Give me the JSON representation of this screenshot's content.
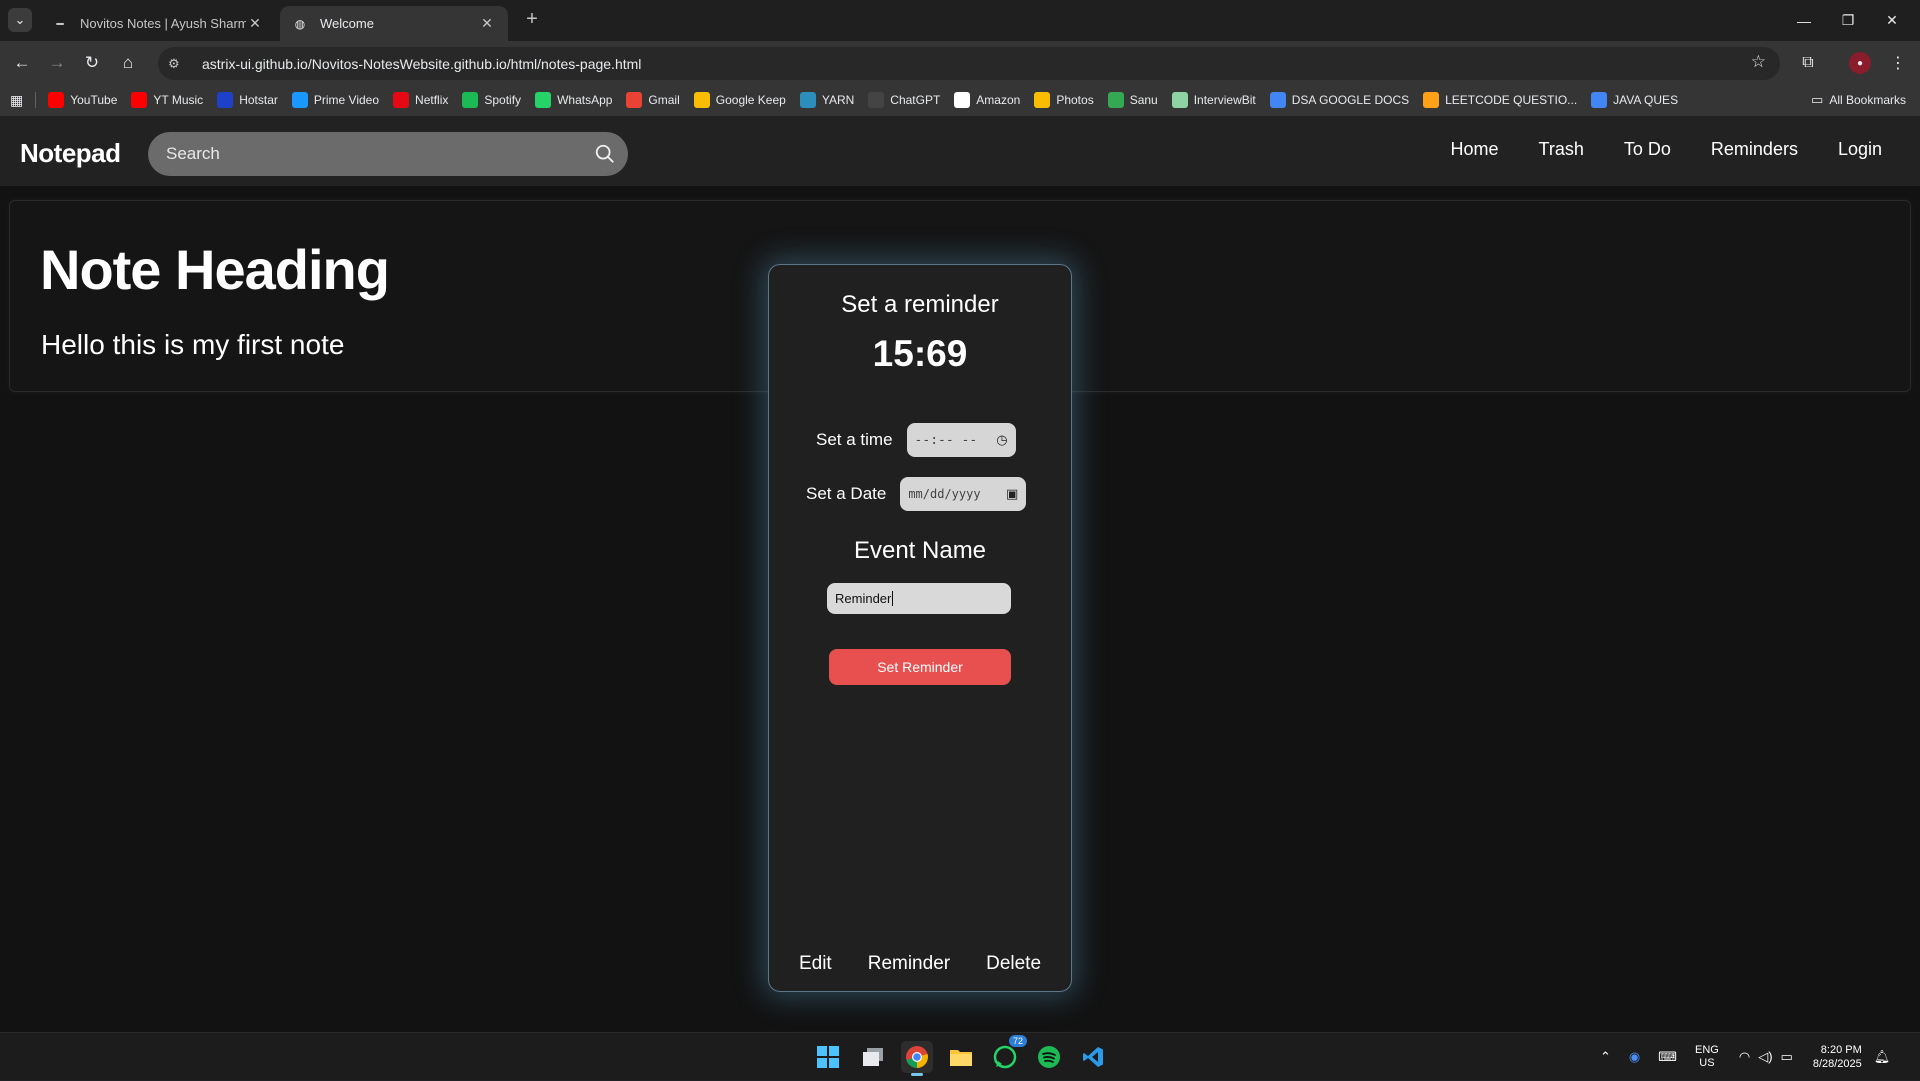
{
  "browser": {
    "tabs": [
      {
        "title": "Novitos Notes | Ayush Sharma",
        "active": false
      },
      {
        "title": "Welcome",
        "active": true
      }
    ],
    "url": "astrix-ui.github.io/Novitos-NotesWebsite.github.io/html/notes-page.html",
    "bookmarks": [
      {
        "label": "YouTube",
        "color": "#ff0000"
      },
      {
        "label": "YT Music",
        "color": "#ff0000"
      },
      {
        "label": "Hotstar",
        "color": "#1f41c9"
      },
      {
        "label": "Prime Video",
        "color": "#1a98ff"
      },
      {
        "label": "Netflix",
        "color": "#e50914"
      },
      {
        "label": "Spotify",
        "color": "#1db954"
      },
      {
        "label": "WhatsApp",
        "color": "#25d366"
      },
      {
        "label": "Gmail",
        "color": "#ea4335"
      },
      {
        "label": "Google Keep",
        "color": "#fbbc04"
      },
      {
        "label": "YARN",
        "color": "#2c8ebb"
      },
      {
        "label": "ChatGPT",
        "color": "#444444"
      },
      {
        "label": "Amazon",
        "color": "#ffffff"
      },
      {
        "label": "Photos",
        "color": "#fbbc04"
      },
      {
        "label": "Sanu",
        "color": "#34a853"
      },
      {
        "label": "InterviewBit",
        "color": "#8fd3a5"
      },
      {
        "label": "DSA GOOGLE DOCS",
        "color": "#4285f4"
      },
      {
        "label": "LEETCODE QUESTIO...",
        "color": "#ffa116"
      },
      {
        "label": "JAVA QUES",
        "color": "#4285f4"
      }
    ],
    "all_bookmarks": "All Bookmarks"
  },
  "app": {
    "brand": "Notepad",
    "search_placeholder": "Search",
    "nav": [
      "Home",
      "Trash",
      "To Do",
      "Reminders",
      "Login"
    ]
  },
  "note": {
    "heading": "Note Heading",
    "body": "Hello this is my first note"
  },
  "reminder": {
    "title": "Set a reminder",
    "clock": "15:69",
    "time_label": "Set a time",
    "time_value": "--:-- --",
    "date_label": "Set a Date",
    "date_value": "mm/dd/yyyy",
    "event_label": "Event Name",
    "event_value": "Reminder",
    "set_button": "Set Reminder",
    "actions": [
      "Edit",
      "Reminder",
      "Delete"
    ]
  },
  "taskbar": {
    "whatsapp_badge": "72",
    "lang": "ENG",
    "region": "US",
    "time": "8:20 PM",
    "date": "8/28/2025"
  }
}
